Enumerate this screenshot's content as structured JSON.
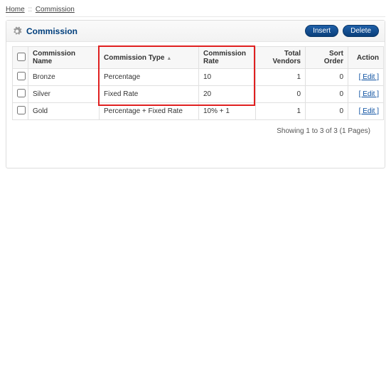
{
  "breadcrumb": {
    "home": "Home",
    "current": "Commission",
    "sep": "::"
  },
  "panel": {
    "title": "Commission"
  },
  "buttons": {
    "insert": "Insert",
    "delete": "Delete"
  },
  "columns": {
    "name": "Commission Name",
    "type": "Commission Type",
    "rate": "Commission Rate",
    "vendors": "Total Vendors",
    "sort": "Sort Order",
    "action": "Action"
  },
  "rows": [
    {
      "name": "Bronze",
      "type": "Percentage",
      "rate": "10",
      "vendors": "1",
      "sort": "0",
      "action": "[ Edit ]"
    },
    {
      "name": "Silver",
      "type": "Fixed Rate",
      "rate": "20",
      "vendors": "0",
      "sort": "0",
      "action": "[ Edit ]"
    },
    {
      "name": "Gold",
      "type": "Percentage + Fixed Rate",
      "rate": "10% + 1",
      "vendors": "1",
      "sort": "0",
      "action": "[ Edit ]"
    }
  ],
  "pager": "Showing 1 to 3 of 3 (1 Pages)"
}
